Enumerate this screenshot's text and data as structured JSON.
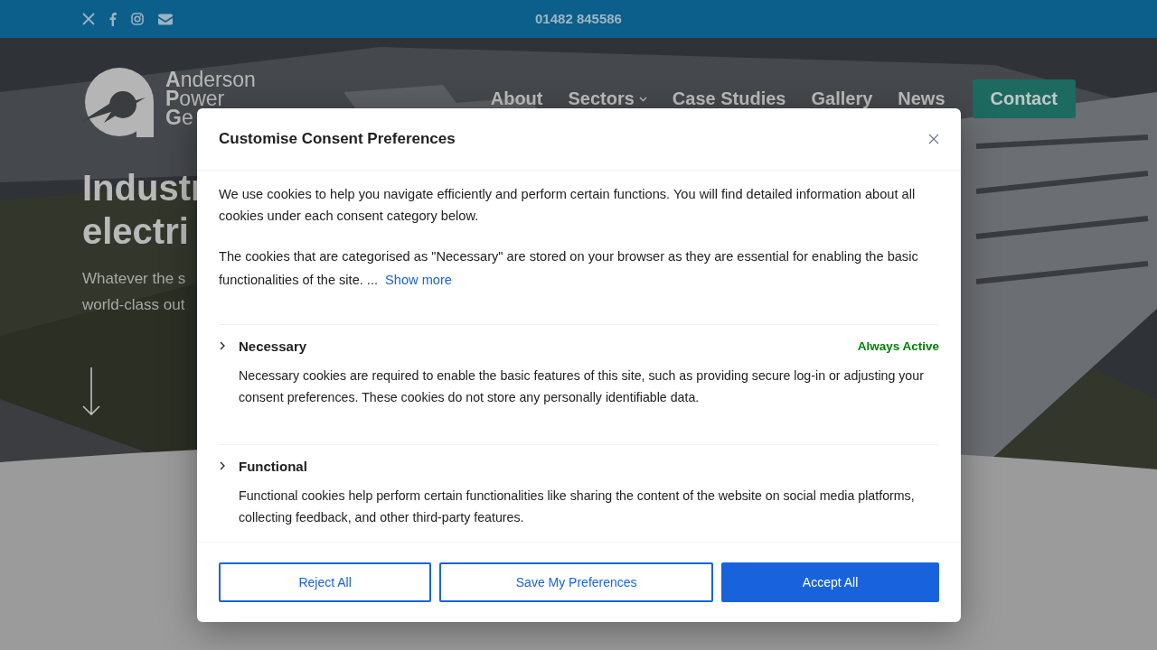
{
  "top_bar": {
    "social": [
      {
        "kind": "x"
      },
      {
        "kind": "facebook"
      },
      {
        "kind": "instagram"
      },
      {
        "kind": "email"
      }
    ],
    "phone": "01482 845586"
  },
  "logo": {
    "lines": [
      "**A**nderson",
      "**P**ower",
      "**G**e"
    ]
  },
  "nav": {
    "items": [
      {
        "label": "About",
        "kind": "link"
      },
      {
        "label": "Sectors",
        "kind": "dropdown"
      },
      {
        "label": "Case Studies",
        "kind": "link"
      },
      {
        "label": "Gallery",
        "kind": "link"
      },
      {
        "label": "News",
        "kind": "link"
      }
    ],
    "contact": "Contact"
  },
  "hero": {
    "title_lines": [
      "Industr",
      "electri"
    ],
    "subtitle_lines": [
      "Whatever the s",
      "world-class out"
    ]
  },
  "consent": {
    "title": "Customise Consent Preferences",
    "intro": "We use cookies to help you navigate efficiently and perform certain functions. You will find detailed information about all cookies under each consent category below.",
    "notice": "The cookies that are categorised as \"Necessary\" are stored on your browser as they are essential for enabling the basic functionalities of the site. ...",
    "show_more": "Show more",
    "categories": [
      {
        "name": "Necessary",
        "status": "Always Active",
        "description": "Necessary cookies are required to enable the basic features of this site, such as providing secure log-in or adjusting your consent preferences. These cookies do not store any personally identifiable data."
      },
      {
        "name": "Functional",
        "description": "Functional cookies help perform certain functionalities like sharing the content of the website on social media platforms, collecting feedback, and other third-party features."
      }
    ],
    "buttons": [
      {
        "label": "Reject All",
        "kind": "outline"
      },
      {
        "label": "Save My Preferences",
        "kind": "outline"
      },
      {
        "label": "Accept All",
        "kind": "filled"
      }
    ]
  }
}
